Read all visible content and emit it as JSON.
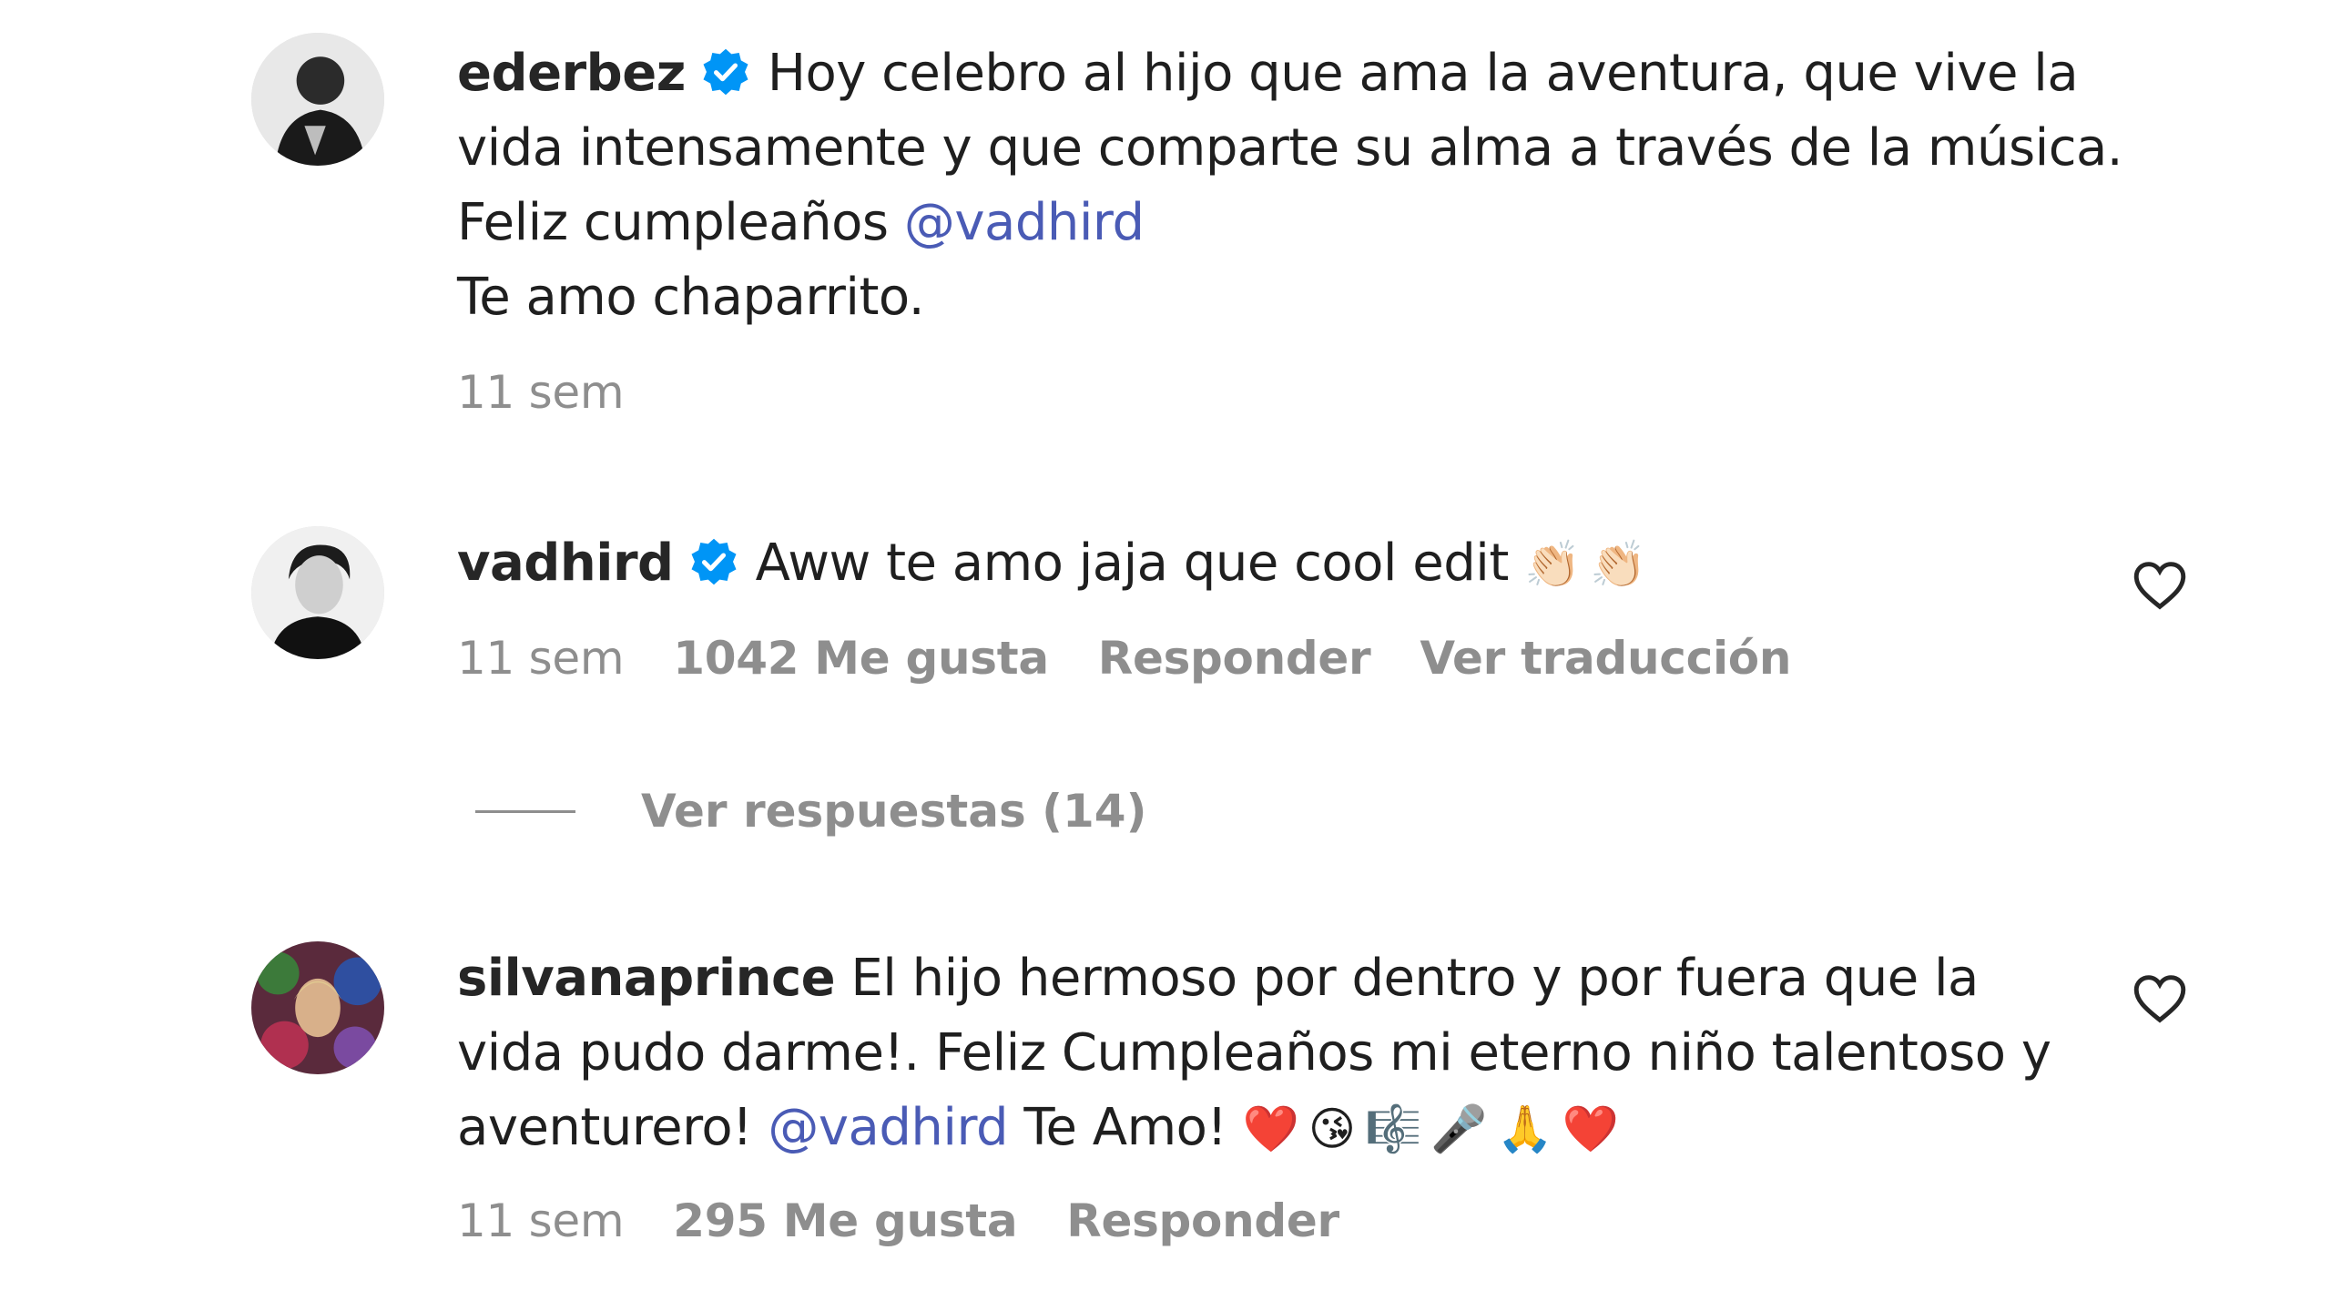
{
  "comments": [
    {
      "username": "ederbez",
      "verified": true,
      "text_line1": "Hoy celebro al hijo que ama la aventura, que vive la",
      "text_line2": "vida intensamente y que comparte su alma a través de la música.",
      "text_line3_prefix": "Feliz cumpleaños ",
      "mention": "@vadhird",
      "text_line4": "Te amo chaparrito.",
      "time": "11 sem"
    },
    {
      "username": "vadhird",
      "verified": true,
      "text": "Aww te amo jaja que cool edit",
      "emojis": "👏🏻👏🏻",
      "time": "11 sem",
      "likes": "1042 Me gusta",
      "reply_label": "Responder",
      "translate_label": "Ver traducción",
      "view_replies": "Ver respuestas (14)"
    },
    {
      "username": "silvanaprince",
      "verified": false,
      "text_line1": " El hijo hermoso por dentro y por fuera que la",
      "text_line2": "vida pudo darme!. Feliz Cumpleaños mi eterno niño talentoso y",
      "text_line3_prefix": "aventurero! ",
      "mention": "@vadhird",
      "text_line3_suffix": " Te Amo! ",
      "emojis": "❤️😘🎼🎤🙏❤️",
      "time": "11 sem",
      "likes": "295 Me gusta",
      "reply_label": "Responder"
    }
  ],
  "icons": {
    "verified": "verified-badge-icon",
    "like": "heart-outline-icon"
  },
  "colors": {
    "verified_blue": "#0095f6",
    "mention": "#4a5bb5",
    "muted": "#8e8e8e",
    "text": "#262626"
  }
}
